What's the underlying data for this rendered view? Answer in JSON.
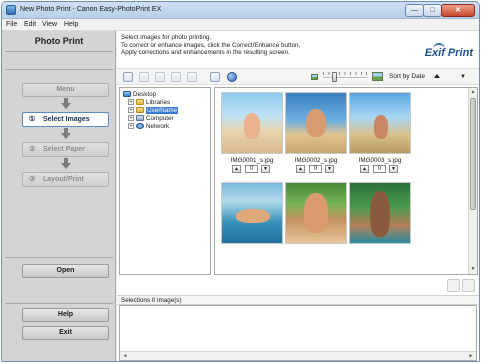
{
  "window": {
    "title": "New Photo Print - Canon Easy-PhotoPrint EX",
    "minimize": "—",
    "maximize": "□",
    "close": "✕"
  },
  "menubar": {
    "items": [
      {
        "label": "File"
      },
      {
        "label": "Edit"
      },
      {
        "label": "View"
      },
      {
        "label": "Help"
      }
    ]
  },
  "left_panel": {
    "title": "Photo Print",
    "menu_button": "Menu",
    "steps": [
      {
        "num": "①",
        "label": "Select Images",
        "state": "active"
      },
      {
        "num": "②",
        "label": "Select Paper",
        "state": "disabled"
      },
      {
        "num": "③",
        "label": "Layout/Print",
        "state": "disabled"
      }
    ],
    "open_button": "Open",
    "help_button": "Help",
    "exit_button": "Exit"
  },
  "instructions": {
    "line1": "Select images for photo printing.",
    "line2": "To correct or enhance images, click the Correct/Enhance button.",
    "line3": "Apply corrections and enhancements in the resulting screen.",
    "brand": "Exif Print"
  },
  "toolbar": {
    "icons": [
      "view-thumbnails-icon",
      "view-grid-icon",
      "correct-enhance-icon",
      "eraser-icon",
      "scanner-icon",
      "settings-icon",
      "globe-icon"
    ],
    "sort_label": "Sort by Date",
    "sort_arrow": "▼"
  },
  "folder_tree": [
    {
      "label": "Desktop",
      "icon": "desktop-icon",
      "expander": "",
      "selected": false
    },
    {
      "label": "Libraries",
      "icon": "folder-icon",
      "expander": "+",
      "selected": false
    },
    {
      "label": "UserName",
      "icon": "user-folder-icon",
      "expander": "+",
      "selected": true
    },
    {
      "label": "Computer",
      "icon": "computer-icon",
      "expander": "+",
      "selected": false
    },
    {
      "label": "Network",
      "icon": "network-icon",
      "expander": "+",
      "selected": false
    }
  ],
  "images": [
    {
      "filename": "IMG0001_s.jpg",
      "copies": "0"
    },
    {
      "filename": "IMG0002_s.jpg",
      "copies": "0"
    },
    {
      "filename": "IMG0003_s.jpg",
      "copies": "0"
    },
    {
      "filename": "",
      "copies": ""
    },
    {
      "filename": "",
      "copies": ""
    },
    {
      "filename": "",
      "copies": ""
    }
  ],
  "spinner": {
    "up": "▲",
    "down": "▼"
  },
  "selections": {
    "label": "Selections 0 image(s)"
  },
  "scroll": {
    "up": "▲",
    "down": "▼",
    "left": "◄",
    "right": "►"
  }
}
